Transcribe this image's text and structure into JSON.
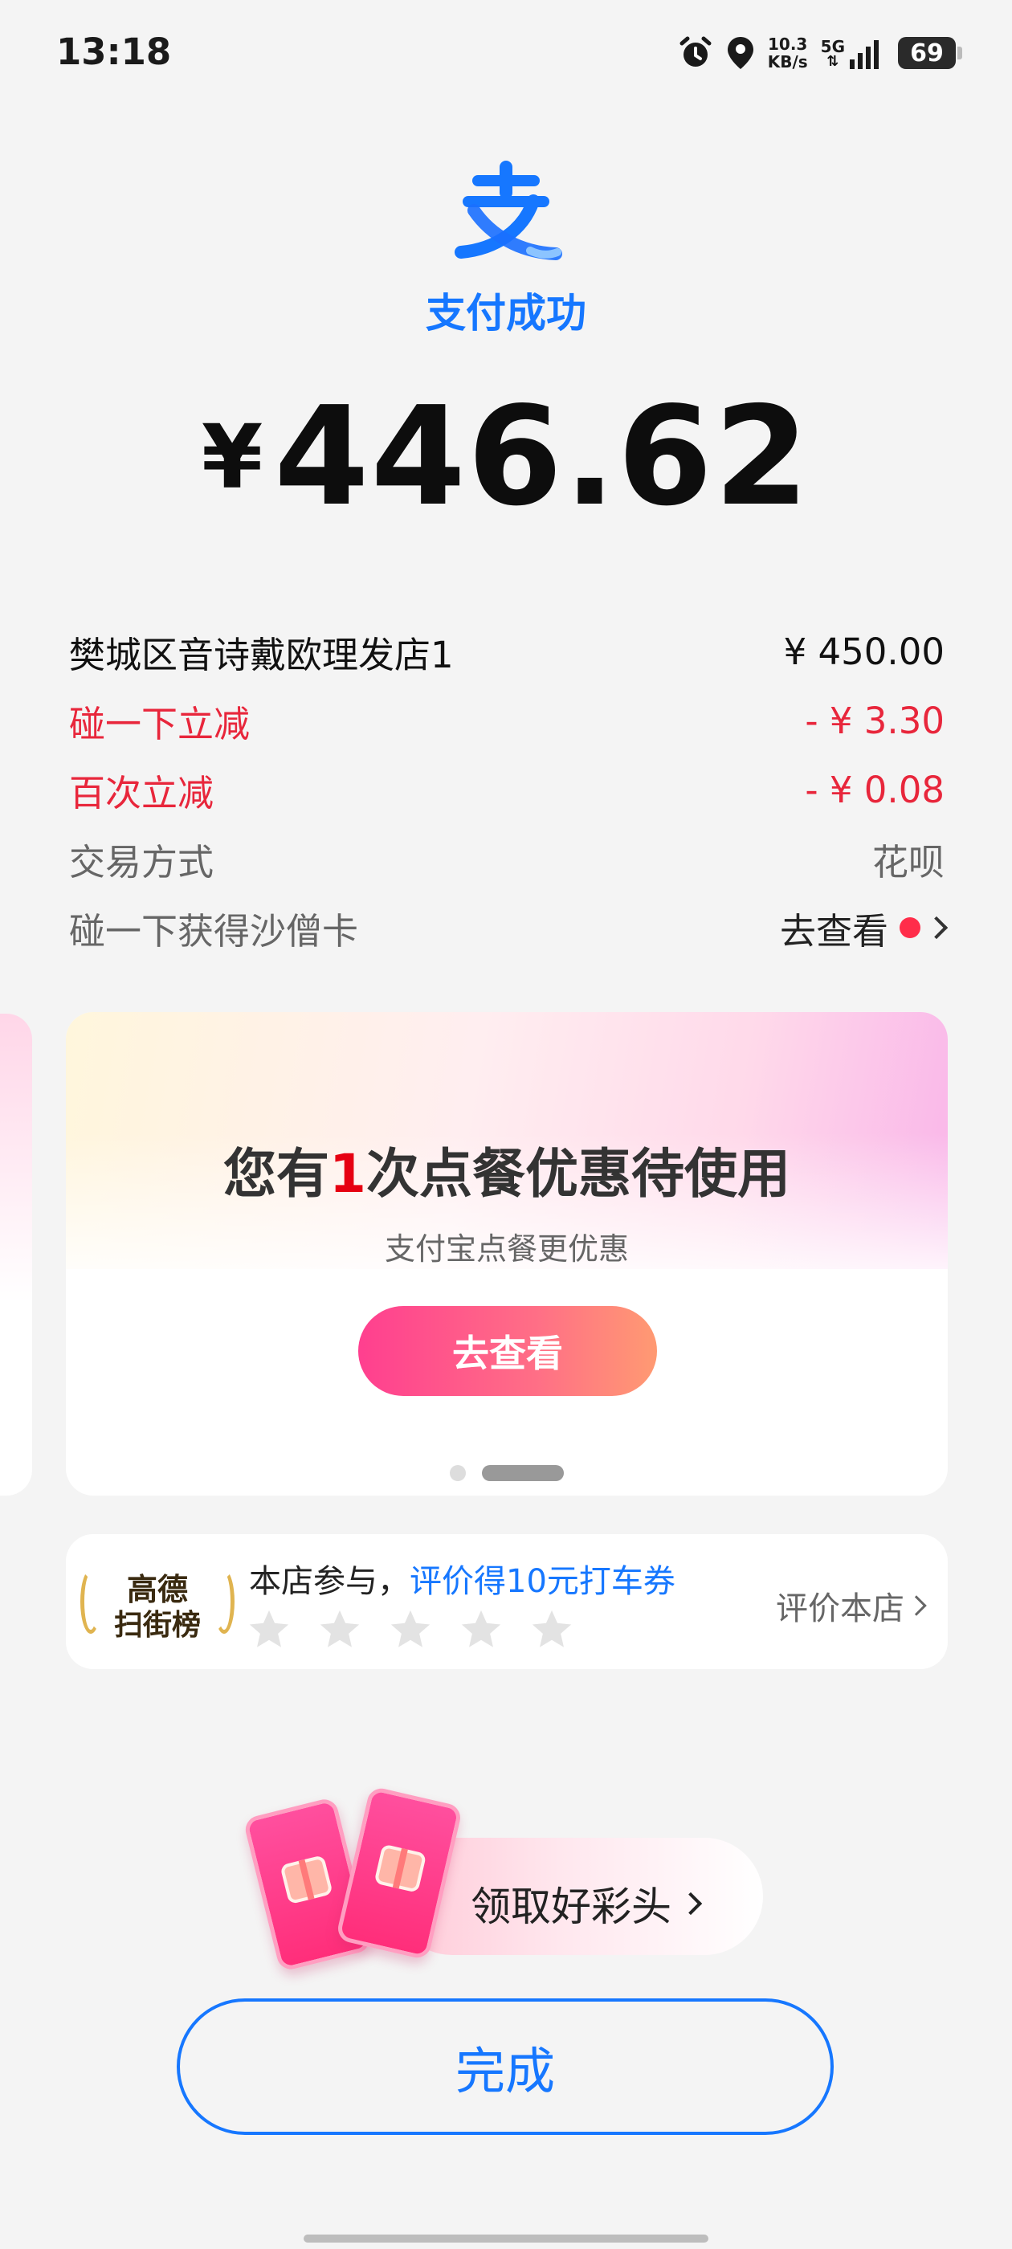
{
  "status_bar": {
    "time": "13:18",
    "net_speed_value": "10.3",
    "net_speed_unit": "KB/s",
    "network": "5G",
    "battery": "69",
    "icons": [
      "alarm-icon",
      "location-icon",
      "signal-icon",
      "battery-icon"
    ]
  },
  "header": {
    "logo": "alipay-logo",
    "title": "支付成功",
    "currency": "¥",
    "amount": "446.62"
  },
  "details": [
    {
      "label": "樊城区音诗戴欧理发店1",
      "value": "¥ 450.00"
    },
    {
      "label": "碰一下立减",
      "value": "- ¥ 3.30"
    },
    {
      "label": "百次立减",
      "value": "- ¥ 0.08"
    },
    {
      "label": "交易方式",
      "value": "花呗"
    },
    {
      "label": "碰一下获得沙僧卡",
      "value": "去查看"
    }
  ],
  "promo": {
    "title_prefix": "您有",
    "title_highlight": "1",
    "title_suffix": "次点餐优惠待使用",
    "subtitle": "支付宝点餐更优惠",
    "button": "去查看",
    "page_count": 2,
    "active_page": 2
  },
  "review": {
    "badge_line1": "高德",
    "badge_line2": "扫街榜",
    "text_prefix": "本店参与，",
    "text_highlight": "评价得10元打车券",
    "star_count": 5,
    "rating": 0,
    "link": "评价本店"
  },
  "gift": {
    "label": "领取好彩头"
  },
  "done_button": "完成",
  "colors": {
    "brand_blue": "#1677ff",
    "discount_red": "#e8263b",
    "promo_pink": "#ff3f8f",
    "background": "#f4f4f4"
  }
}
